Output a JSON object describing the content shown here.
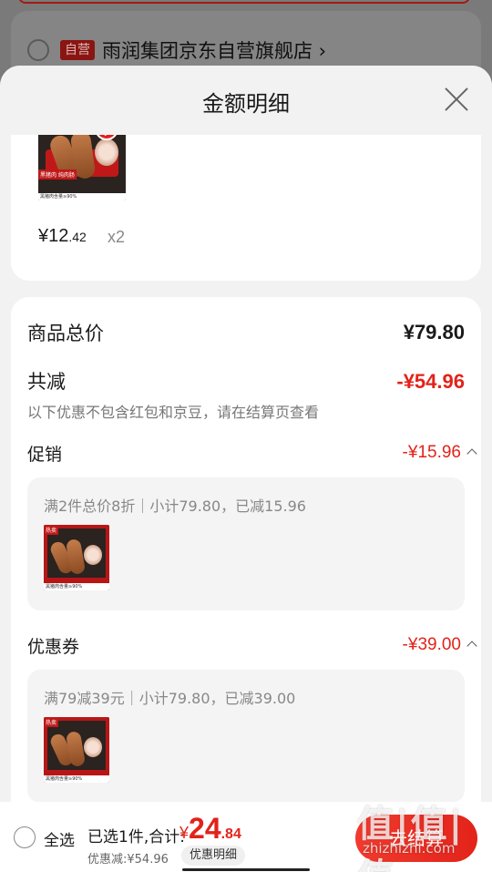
{
  "background": {
    "store_tag": "自营",
    "store_name": "雨润集团京东自营旗舰店 ›"
  },
  "sheet": {
    "title": "金额明细"
  },
  "product": {
    "price_int": "¥12",
    "price_dec": ".42",
    "quantity": "x2",
    "thumb_badge": "黑猪肉 纯肉肠",
    "thumb_caption": "黑猪肉含量≥90%"
  },
  "summary": {
    "total_label": "商品总价",
    "total_value": "¥79.80",
    "reduce_label": "共减",
    "reduce_value": "-¥54.96",
    "note": "以下优惠不包含红包和京豆，请在结算页查看"
  },
  "promotion": {
    "label": "促销",
    "value": "-¥15.96",
    "detail": "满2件总价8折｜小计79.80，已减15.96",
    "thumb_badge": "热卖",
    "thumb_caption": "黑猪肉含量≥90%"
  },
  "coupon": {
    "label": "优惠券",
    "value": "-¥39.00",
    "detail": "满79减39元｜小计79.80，已减39.00",
    "thumb_badge": "热卖",
    "thumb_caption": "黑猪肉含量≥90%"
  },
  "bottom_bar": {
    "select_all": "全选",
    "selected_text": "已选1件,合计:",
    "total_currency": "¥",
    "total_int": "24",
    "total_dec": ".84",
    "discount_text": "优惠减:¥54.96",
    "detail_button": "优惠明细",
    "checkout_button": "去结算"
  },
  "watermark": {
    "title": "值|值|值",
    "site": "zhizhizhi.com"
  },
  "colors": {
    "accent_red": "#e2231a",
    "sheet_bg": "#f2f2f2"
  }
}
